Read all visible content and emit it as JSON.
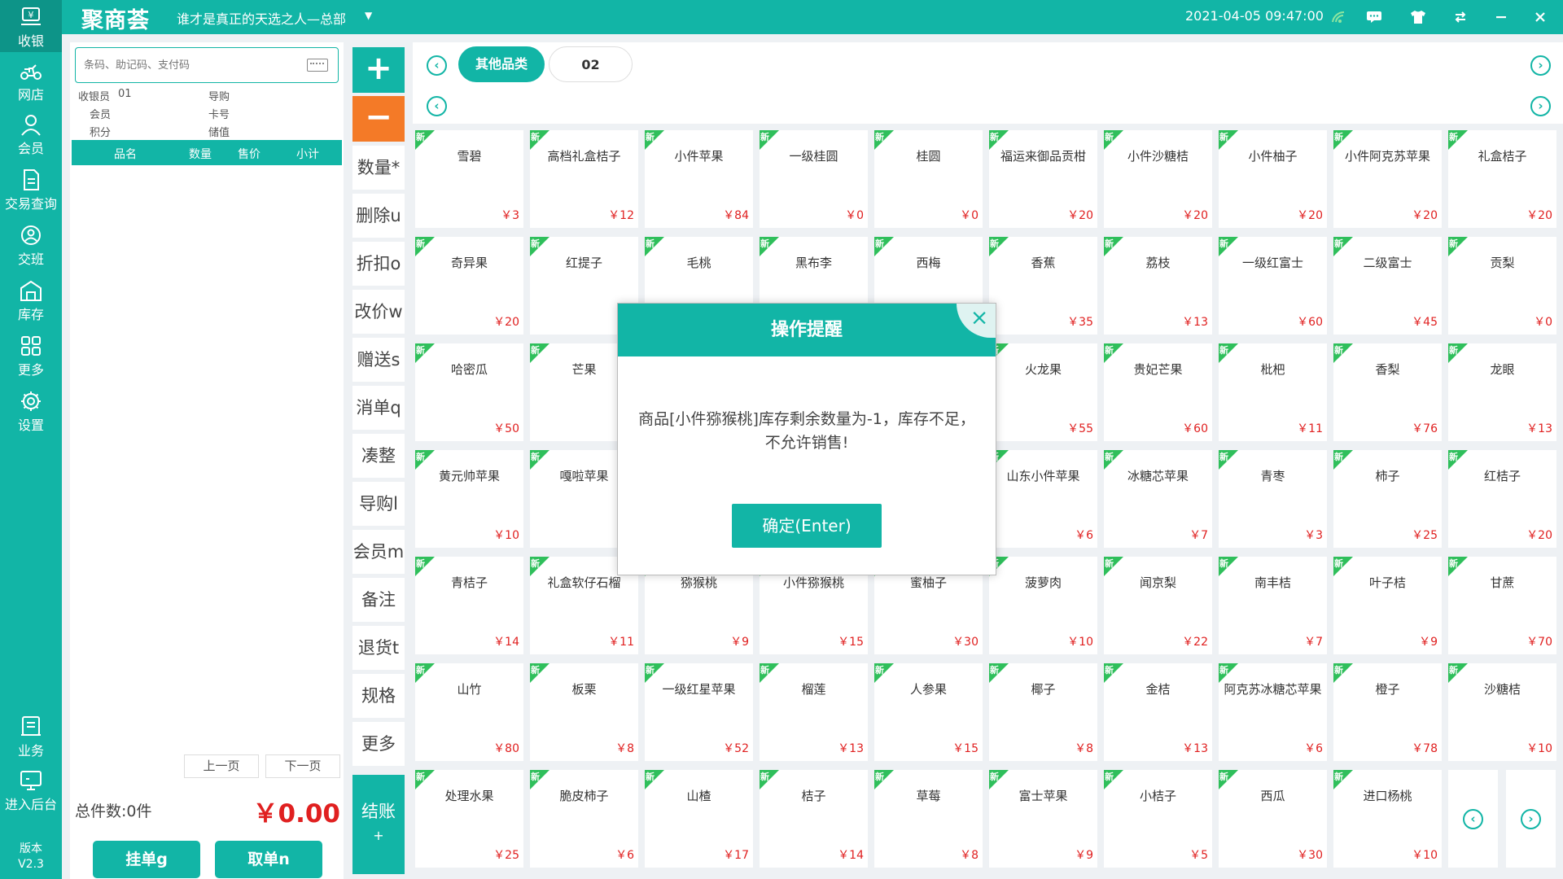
{
  "header": {
    "logo": "聚商荟",
    "store": "谁才是真正的天选之人—总部",
    "datetime": "2021-04-05 09:47:00"
  },
  "nav": {
    "items": [
      {
        "label": "收银",
        "icon": "cash-register-icon"
      },
      {
        "label": "网店",
        "icon": "delivery-scooter-icon"
      },
      {
        "label": "会员",
        "icon": "user-icon"
      },
      {
        "label": "交易查询",
        "icon": "document-icon"
      },
      {
        "label": "交班",
        "icon": "shift-user-icon"
      },
      {
        "label": "库存",
        "icon": "warehouse-icon"
      },
      {
        "label": "更多",
        "icon": "grid-icon"
      },
      {
        "label": "设置",
        "icon": "gear-icon"
      },
      {
        "label": "业务",
        "icon": "business-book-icon"
      },
      {
        "label": "进入后台",
        "icon": "monitor-icon"
      }
    ],
    "version_label": "版本",
    "version": "V2.3"
  },
  "cart": {
    "search_placeholder": "条码、助记码、支付码",
    "cashier_label": "收银员",
    "cashier_value": "01",
    "guide_label": "导购",
    "member_label": "会员",
    "card_label": "卡号",
    "points_label": "积分",
    "balance_label": "储值",
    "columns": [
      "品名",
      "数量",
      "售价",
      "小计"
    ],
    "prev_page": "上一页",
    "next_page": "下一页",
    "total_count": "总件数:0件",
    "total_amount": "￥0.00",
    "hold_button": "挂单g",
    "retrieve_button": "取单n"
  },
  "functions": {
    "plus": "+",
    "minus": "−",
    "buttons": [
      "数量*",
      "删除u",
      "折扣o",
      "改价w",
      "赠送s",
      "消单q",
      "凑整",
      "导购l",
      "会员m",
      "备注",
      "退货t",
      "规格",
      "更多"
    ],
    "checkout_label": "结账",
    "checkout_sub": "+"
  },
  "categories": {
    "tabs": [
      "其他品类",
      "02"
    ]
  },
  "products": {
    "new_tag": "新",
    "items": [
      {
        "name": "雪碧",
        "price": "￥3"
      },
      {
        "name": "高档礼盒桔子",
        "price": "￥12"
      },
      {
        "name": "小件苹果",
        "price": "￥84"
      },
      {
        "name": "一级桂圆",
        "price": "￥0"
      },
      {
        "name": "桂圆",
        "price": "￥0"
      },
      {
        "name": "福运来御品贡柑",
        "price": "￥20"
      },
      {
        "name": "小件沙糖桔",
        "price": "￥20"
      },
      {
        "name": "小件柚子",
        "price": "￥20"
      },
      {
        "name": "小件阿克苏苹果",
        "price": "￥20"
      },
      {
        "name": "礼盒桔子",
        "price": "￥20"
      },
      {
        "name": "奇异果",
        "price": "￥20"
      },
      {
        "name": "红提子",
        "price": "￥"
      },
      {
        "name": "毛桃",
        "price": ""
      },
      {
        "name": "黑布李",
        "price": ""
      },
      {
        "name": "西梅",
        "price": ""
      },
      {
        "name": "香蕉",
        "price": "￥35"
      },
      {
        "name": "荔枝",
        "price": "￥13"
      },
      {
        "name": "一级红富士",
        "price": "￥60"
      },
      {
        "name": "二级富士",
        "price": "￥45"
      },
      {
        "name": "贡梨",
        "price": "￥0"
      },
      {
        "name": "哈密瓜",
        "price": "￥50"
      },
      {
        "name": "芒果",
        "price": "￥"
      },
      {
        "name": "",
        "price": ""
      },
      {
        "name": "",
        "price": ""
      },
      {
        "name": "",
        "price": ""
      },
      {
        "name": "火龙果",
        "price": "￥55"
      },
      {
        "name": "贵妃芒果",
        "price": "￥60"
      },
      {
        "name": "枇杷",
        "price": "￥11"
      },
      {
        "name": "香梨",
        "price": "￥76"
      },
      {
        "name": "龙眼",
        "price": "￥13"
      },
      {
        "name": "黄元帅苹果",
        "price": "￥10"
      },
      {
        "name": "嘎啦苹果",
        "price": "￥"
      },
      {
        "name": "",
        "price": ""
      },
      {
        "name": "",
        "price": ""
      },
      {
        "name": "",
        "price": ""
      },
      {
        "name": "山东小件苹果",
        "price": "￥6"
      },
      {
        "name": "冰糖芯苹果",
        "price": "￥7"
      },
      {
        "name": "青枣",
        "price": "￥3"
      },
      {
        "name": "柿子",
        "price": "￥25"
      },
      {
        "name": "红桔子",
        "price": "￥20"
      },
      {
        "name": "青桔子",
        "price": "￥14"
      },
      {
        "name": "礼盒软仔石榴",
        "price": "￥11"
      },
      {
        "name": "猕猴桃",
        "price": "￥9"
      },
      {
        "name": "小件猕猴桃",
        "price": "￥15"
      },
      {
        "name": "蜜柚子",
        "price": "￥30"
      },
      {
        "name": "菠萝肉",
        "price": "￥10"
      },
      {
        "name": "闻京梨",
        "price": "￥22"
      },
      {
        "name": "南丰桔",
        "price": "￥7"
      },
      {
        "name": "叶子桔",
        "price": "￥9"
      },
      {
        "name": "甘蔗",
        "price": "￥70"
      },
      {
        "name": "山竹",
        "price": "￥80"
      },
      {
        "name": "板栗",
        "price": "￥8"
      },
      {
        "name": "一级红星苹果",
        "price": "￥52"
      },
      {
        "name": "榴莲",
        "price": "￥13"
      },
      {
        "name": "人参果",
        "price": "￥15"
      },
      {
        "name": "椰子",
        "price": "￥8"
      },
      {
        "name": "金桔",
        "price": "￥13"
      },
      {
        "name": "阿克苏冰糖芯苹果",
        "price": "￥6"
      },
      {
        "name": "橙子",
        "price": "￥78"
      },
      {
        "name": "沙糖桔",
        "price": "￥10"
      },
      {
        "name": "处理水果",
        "price": "￥25"
      },
      {
        "name": "脆皮柿子",
        "price": "￥6"
      },
      {
        "name": "山楂",
        "price": "￥17"
      },
      {
        "name": "桔子",
        "price": "￥14"
      },
      {
        "name": "草莓",
        "price": "￥8"
      },
      {
        "name": "富士苹果",
        "price": "￥9"
      },
      {
        "name": "小桔子",
        "price": "￥5"
      },
      {
        "name": "西瓜",
        "price": "￥30"
      },
      {
        "name": "进口杨桃",
        "price": "￥10"
      }
    ]
  },
  "modal": {
    "title": "操作提醒",
    "message": "商品[小件猕猴桃]库存剩余数量为-1，库存不足，不允许销售!",
    "ok_button": "确定(Enter)"
  },
  "colors": {
    "primary": "#12b5a6",
    "accent_orange": "#f47a27",
    "price_red": "#e02020",
    "new_tag_green": "#2fbf5b"
  }
}
